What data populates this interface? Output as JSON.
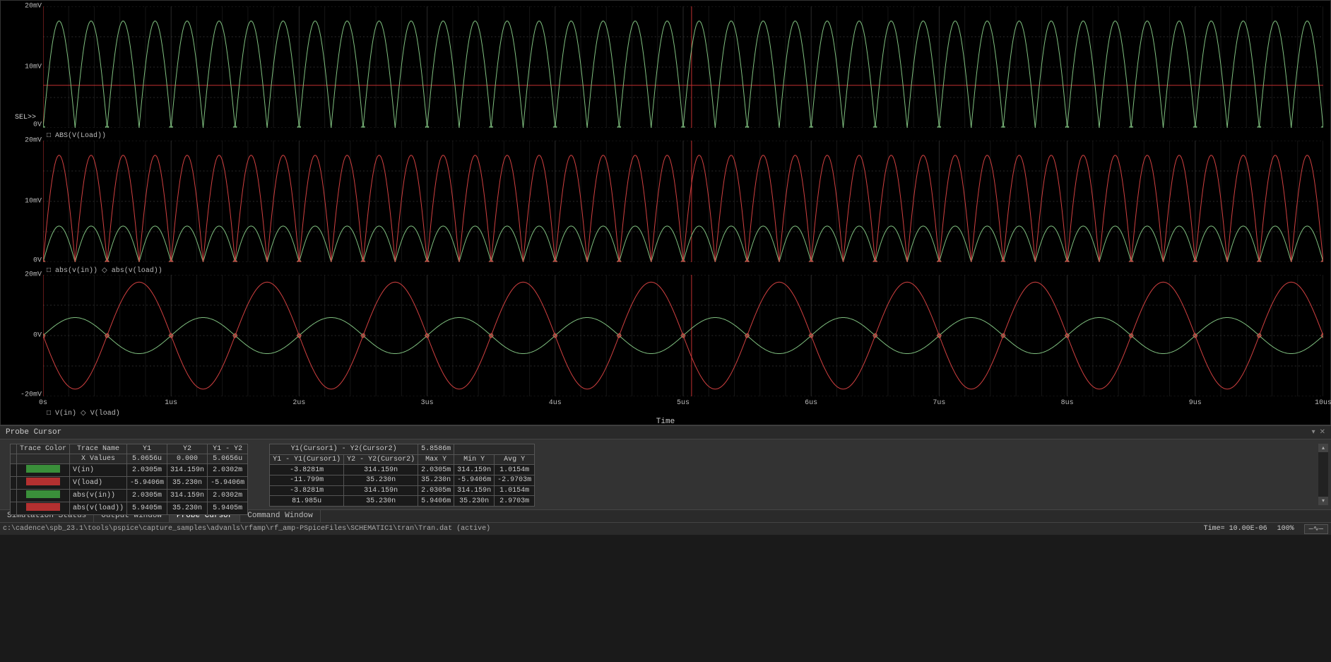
{
  "chart_data": [
    {
      "type": "line",
      "title": "ABS(V(Load))",
      "xlabel": "Time",
      "ylabel": "",
      "xlim_us": [
        0,
        10
      ],
      "ylim_mV": [
        0,
        20
      ],
      "y_ticks": [
        "20mV",
        "10mV",
        "0V"
      ],
      "series": [
        {
          "name": "ABS(V(Load))",
          "color": "#7fbf7f",
          "marker": "square",
          "freq_MHz": 2,
          "amplitude_mV": 17.6,
          "offset_mV": 0,
          "fn": "abs_sin"
        }
      ],
      "cursor1_us": 5.0656,
      "cursor2_us": 0.0,
      "hline_mV": 7
    },
    {
      "type": "line",
      "title": "abs(v(in)) / abs(v(load))",
      "xlabel": "Time",
      "ylabel": "",
      "xlim_us": [
        0,
        10
      ],
      "ylim_mV": [
        0,
        20
      ],
      "y_ticks": [
        "20mV",
        "10mV",
        "0V"
      ],
      "series": [
        {
          "name": "abs(v(in))",
          "color": "#7fbf7f",
          "marker": "square",
          "freq_MHz": 2,
          "amplitude_mV": 5.94,
          "offset_mV": 0,
          "fn": "abs_sin"
        },
        {
          "name": "abs(v(load))",
          "color": "#d04040",
          "marker": "diamond",
          "freq_MHz": 2,
          "amplitude_mV": 17.6,
          "offset_mV": 0,
          "fn": "abs_sin"
        }
      ],
      "cursor1_us": 5.0656,
      "cursor2_us": 0.0
    },
    {
      "type": "line",
      "title": "V(in) / V(load)",
      "xlabel": "Time",
      "ylabel": "",
      "xlim_us": [
        0,
        10
      ],
      "ylim_mV": [
        -20,
        20
      ],
      "y_ticks": [
        "20mV",
        "0V",
        "-20mV"
      ],
      "series": [
        {
          "name": "V(in)",
          "color": "#7fbf7f",
          "marker": "square",
          "freq_MHz": 1,
          "amplitude_mV": 5.94,
          "offset_mV": 0,
          "fn": "sin"
        },
        {
          "name": "V(load)",
          "color": "#d04040",
          "marker": "diamond",
          "freq_MHz": 1,
          "amplitude_mV": 17.6,
          "offset_mV": 0,
          "fn": "sin_neg"
        }
      ],
      "cursor1_us": 5.0656,
      "cursor2_us": 0.0
    }
  ],
  "x_ticks": [
    "0s",
    "1us",
    "2us",
    "3us",
    "4us",
    "5us",
    "6us",
    "7us",
    "8us",
    "9us",
    "10us"
  ],
  "x_label": "Time",
  "sel_label": "SEL>>",
  "legends": {
    "p1": "□ ABS(V(Load))",
    "p2": "□ abs(v(in))   ◇ abs(v(load))",
    "p3": "□ V(in)   ◇ V(load)"
  },
  "probe_panel_title": "Probe Cursor",
  "cursor_table_a": {
    "headers": [
      "",
      "Trace Color",
      "Trace Name",
      "Y1",
      "Y2",
      "Y1 - Y2"
    ],
    "x_row": [
      "",
      "",
      "X Values",
      "5.0656u",
      "0.000",
      "5.0656u"
    ],
    "rows": [
      {
        "swatch": "sw-green",
        "name": "V(in)",
        "y1": "2.0305m",
        "y2": "314.159n",
        "diff": "2.0302m"
      },
      {
        "swatch": "sw-red",
        "name": "V(load)",
        "y1": "-5.9406m",
        "y2": "35.230n",
        "diff": "-5.9406m"
      },
      {
        "swatch": "sw-green",
        "name": "abs(v(in))",
        "y1": "2.0305m",
        "y2": "314.159n",
        "diff": "2.0302m"
      },
      {
        "swatch": "sw-red",
        "name": "abs(v(load))",
        "y1": "5.9405m",
        "y2": "35.230n",
        "diff": "5.9405m"
      }
    ]
  },
  "cursor_table_b": {
    "headers": [
      "Y1(Cursor1) - Y2(Cursor2)",
      "5.8586m",
      ""
    ],
    "sub_headers": [
      "Y1 - Y1(Cursor1)",
      "Y2 - Y2(Cursor2)",
      "Max Y",
      "Min Y",
      "Avg Y"
    ],
    "rows": [
      [
        "-3.8281m",
        "314.159n",
        "2.0305m",
        "314.159n",
        "1.0154m"
      ],
      [
        "-11.799m",
        "35.230n",
        "35.230n",
        "-5.9406m",
        "-2.9703m"
      ],
      [
        "-3.8281m",
        "314.159n",
        "2.0305m",
        "314.159n",
        "1.0154m"
      ],
      [
        "81.985u",
        "35.230n",
        "5.9406m",
        "35.230n",
        "2.9703m"
      ]
    ]
  },
  "tabs": [
    "Simulation Status",
    "Output Window",
    "Probe Cursor",
    "Command Window"
  ],
  "active_tab": 2,
  "status": {
    "file": "c:\\cadence\\spb_23.1\\tools\\pspice\\capture_samples\\advanls\\rfamp\\rf_amp-PSpiceFiles\\SCHEMATIC1\\tran\\Tran.dat (active)",
    "time": "Time= 10.00E-06",
    "pct": "100%"
  }
}
